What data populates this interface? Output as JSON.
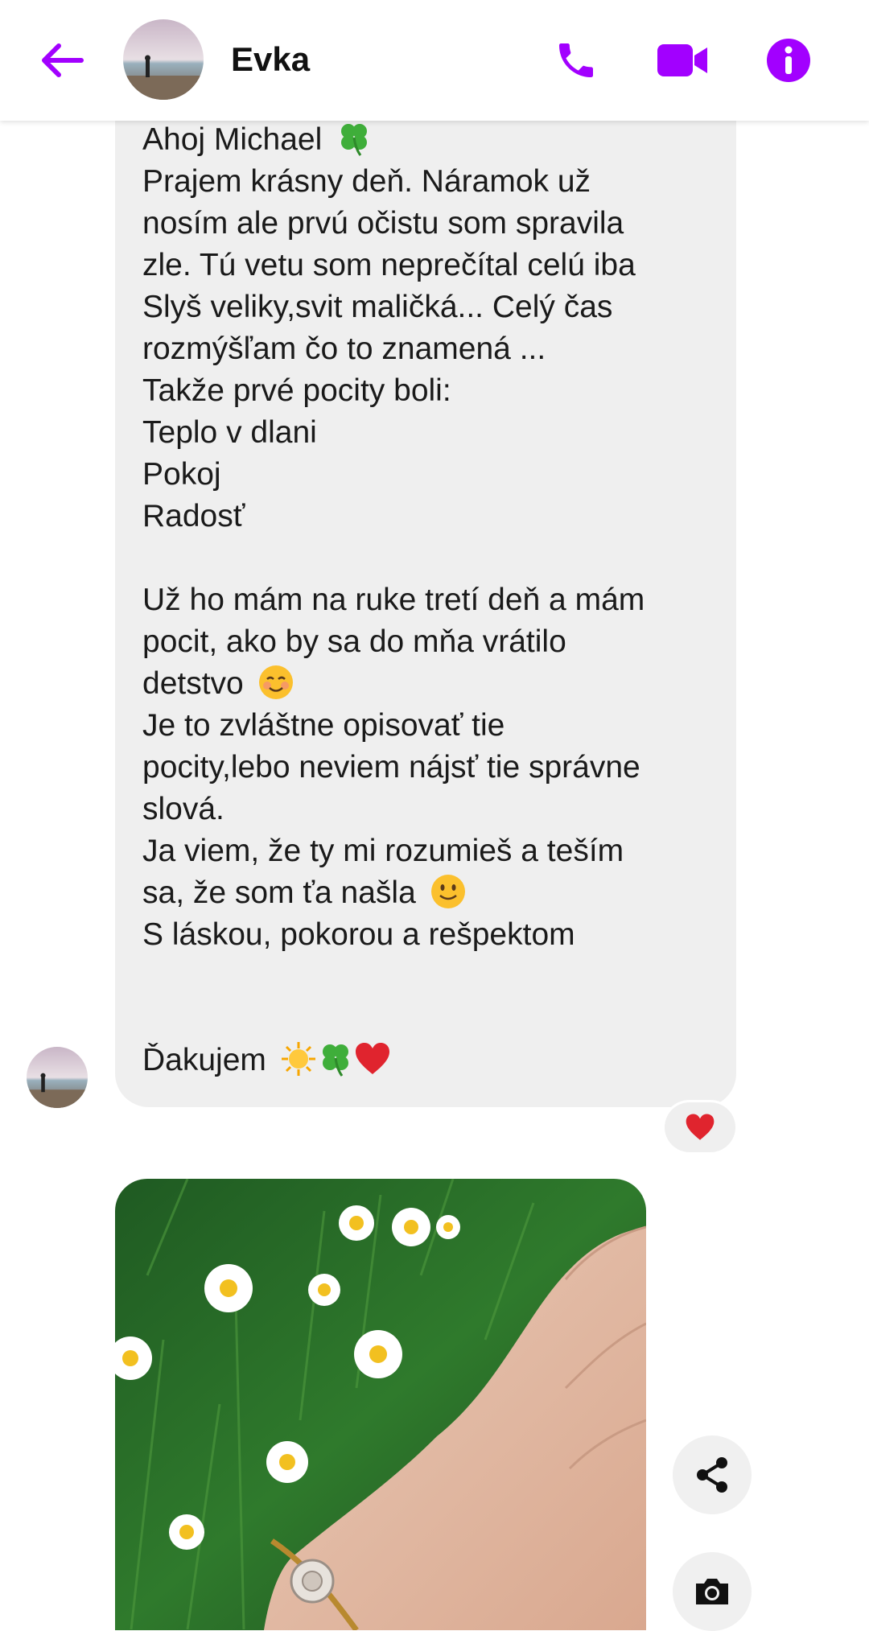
{
  "header": {
    "contact_name": "Evka",
    "accent_color": "#a200ff",
    "icons": [
      "back-arrow-icon",
      "phone-icon",
      "video-camera-icon",
      "info-icon"
    ]
  },
  "message": {
    "lines": [
      {
        "text": "Ahoj Michael ",
        "emoji": [
          "four-leaf-clover"
        ]
      },
      {
        "text": "Prajem krásny deň. Náramok už"
      },
      {
        "text": "nosím ale prvú očistu som spravila"
      },
      {
        "text": "zle. Tú vetu som neprečítal celú iba"
      },
      {
        "text": "Slyš veliky,svit maličká... Celý čas"
      },
      {
        "text": "rozmýšľam čo to znamená ..."
      },
      {
        "text": "Takže prvé pocity boli:"
      },
      {
        "text": "Teplo v dlani"
      },
      {
        "text": "Pokoj"
      },
      {
        "text": "Radosť"
      },
      {
        "text": ""
      },
      {
        "text": "Už ho mám na ruke tretí deň a mám"
      },
      {
        "text": "pocit, ako by sa do mňa vrátilo"
      },
      {
        "text": "detstvo ",
        "emoji": [
          "smiling-blush-face"
        ]
      },
      {
        "text": "Je to zvláštne opisovať tie"
      },
      {
        "text": "pocity,lebo neviem nájsť tie správne"
      },
      {
        "text": "slová."
      },
      {
        "text": "Ja viem, že ty mi rozumieš a teším"
      },
      {
        "text": "sa, že som ťa našla ",
        "emoji": [
          "slight-smile-face"
        ]
      },
      {
        "text": "S láskou, pokorou a rešpektom"
      },
      {
        "text": ""
      },
      {
        "text": ""
      },
      {
        "text": "Ďakujem ",
        "emoji": [
          "sun",
          "four-leaf-clover",
          "red-heart"
        ]
      }
    ],
    "bubble_color": "#efefef"
  },
  "reaction": {
    "icon": "red-heart-icon"
  },
  "photo": {
    "subject": "hand-with-bracelet-among-daisies"
  },
  "actions": {
    "icons": [
      "share-icon",
      "camera-icon"
    ]
  }
}
